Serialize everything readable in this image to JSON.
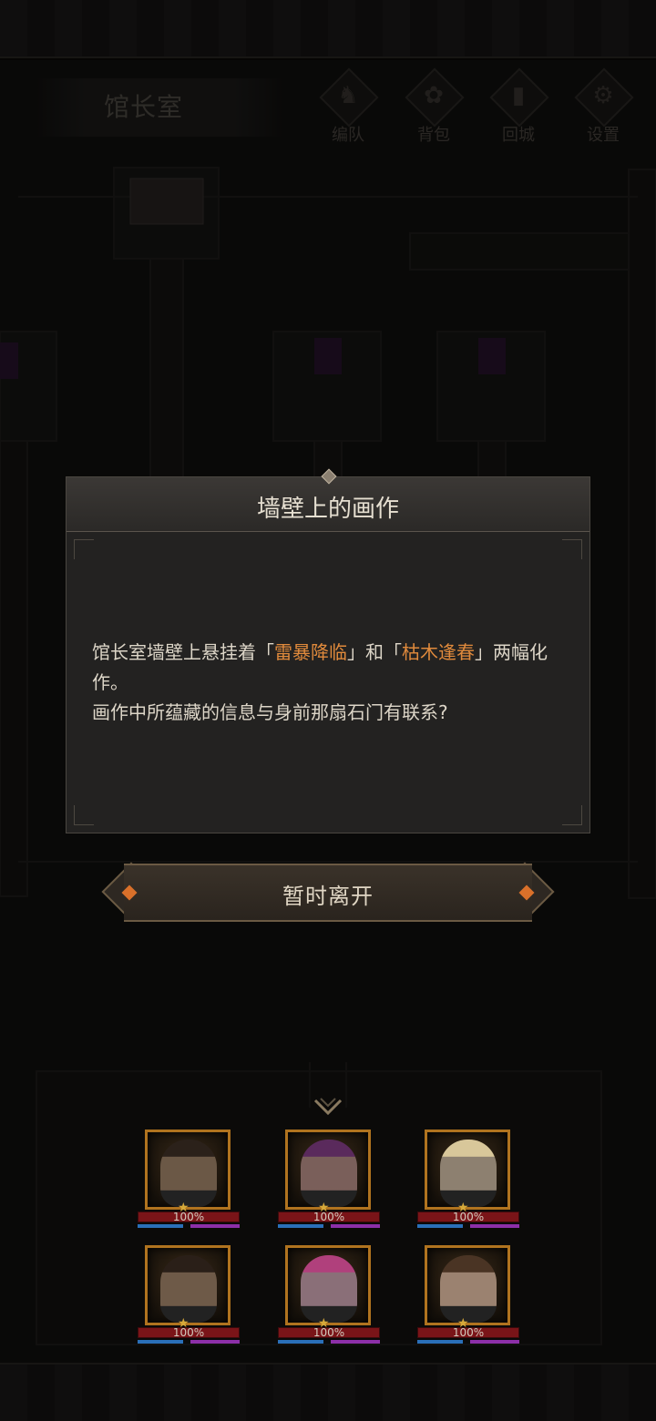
{
  "header": {
    "room_name": "馆长室"
  },
  "toolbar": [
    {
      "label": "编队",
      "icon": "helmet-icon",
      "glyph": "♞"
    },
    {
      "label": "背包",
      "icon": "bag-icon",
      "glyph": "✿"
    },
    {
      "label": "回城",
      "icon": "door-icon",
      "glyph": "▮"
    },
    {
      "label": "设置",
      "icon": "gear-icon",
      "glyph": "⚙"
    }
  ],
  "dialog": {
    "title": "墙壁上的画作",
    "text_1": "馆长室墙壁上悬挂着「",
    "painting_1": "雷暴降临",
    "text_2": "」和「",
    "painting_2": "枯木逢春",
    "text_3": "」两幅化作。",
    "line_2": "画作中所蕴藏的信息与身前那扇石门有联系?"
  },
  "actions": {
    "leave_label": "暂时离开"
  },
  "party": [
    {
      "hp": "100%",
      "skin": "#6b5846",
      "hair": "#2b211a"
    },
    {
      "hp": "100%",
      "skin": "#7a5f5a",
      "hair": "#5a2a5c"
    },
    {
      "hp": "100%",
      "skin": "#8d8070",
      "hair": "#d8c79a"
    },
    {
      "hp": "100%",
      "skin": "#6e5a48",
      "hair": "#2a1f18"
    },
    {
      "hp": "100%",
      "skin": "#8a6f78",
      "hair": "#b0407c"
    },
    {
      "hp": "100%",
      "skin": "#9b8270",
      "hair": "#4a3424"
    }
  ],
  "colors": {
    "highlight": "#e08a3c",
    "frame_gold": "#b0731f",
    "hp_red": "#7a1418"
  }
}
